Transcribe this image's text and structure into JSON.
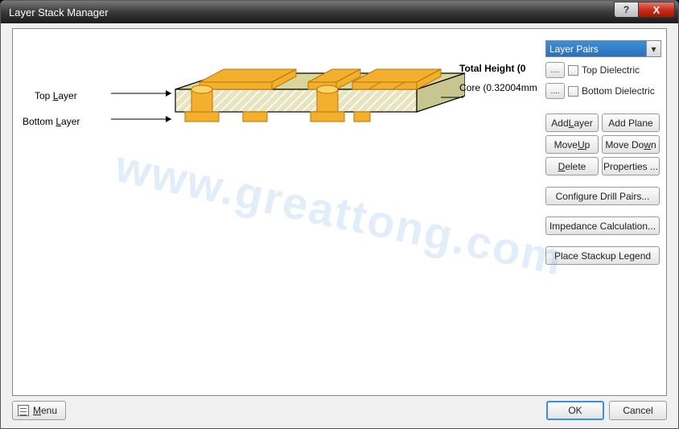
{
  "window": {
    "title": "Layer Stack Manager",
    "help_label": "?",
    "close_label": "X"
  },
  "diagram": {
    "top_layer_label": "Top Layer",
    "bottom_layer_label": "Bottom Layer",
    "total_height_label": "Total Height (0",
    "core_label": "Core (0.32004mm"
  },
  "panel": {
    "combo_selected": "Layer Pairs",
    "top_dielectric_label": "Top Dielectric",
    "bottom_dielectric_label": "Bottom Dielectric",
    "dots_label": "....",
    "add_layer": "Add Layer",
    "add_plane": "Add Plane",
    "move_up": "Move Up",
    "move_down": "Move Down",
    "delete": "Delete",
    "properties": "Properties ...",
    "configure_drill": "Configure Drill Pairs...",
    "impedance_calc": "Impedance Calculation...",
    "place_legend": "Place Stackup Legend"
  },
  "footer": {
    "menu": "Menu",
    "ok": "OK",
    "cancel": "Cancel"
  },
  "watermark": "www.greattong.com"
}
